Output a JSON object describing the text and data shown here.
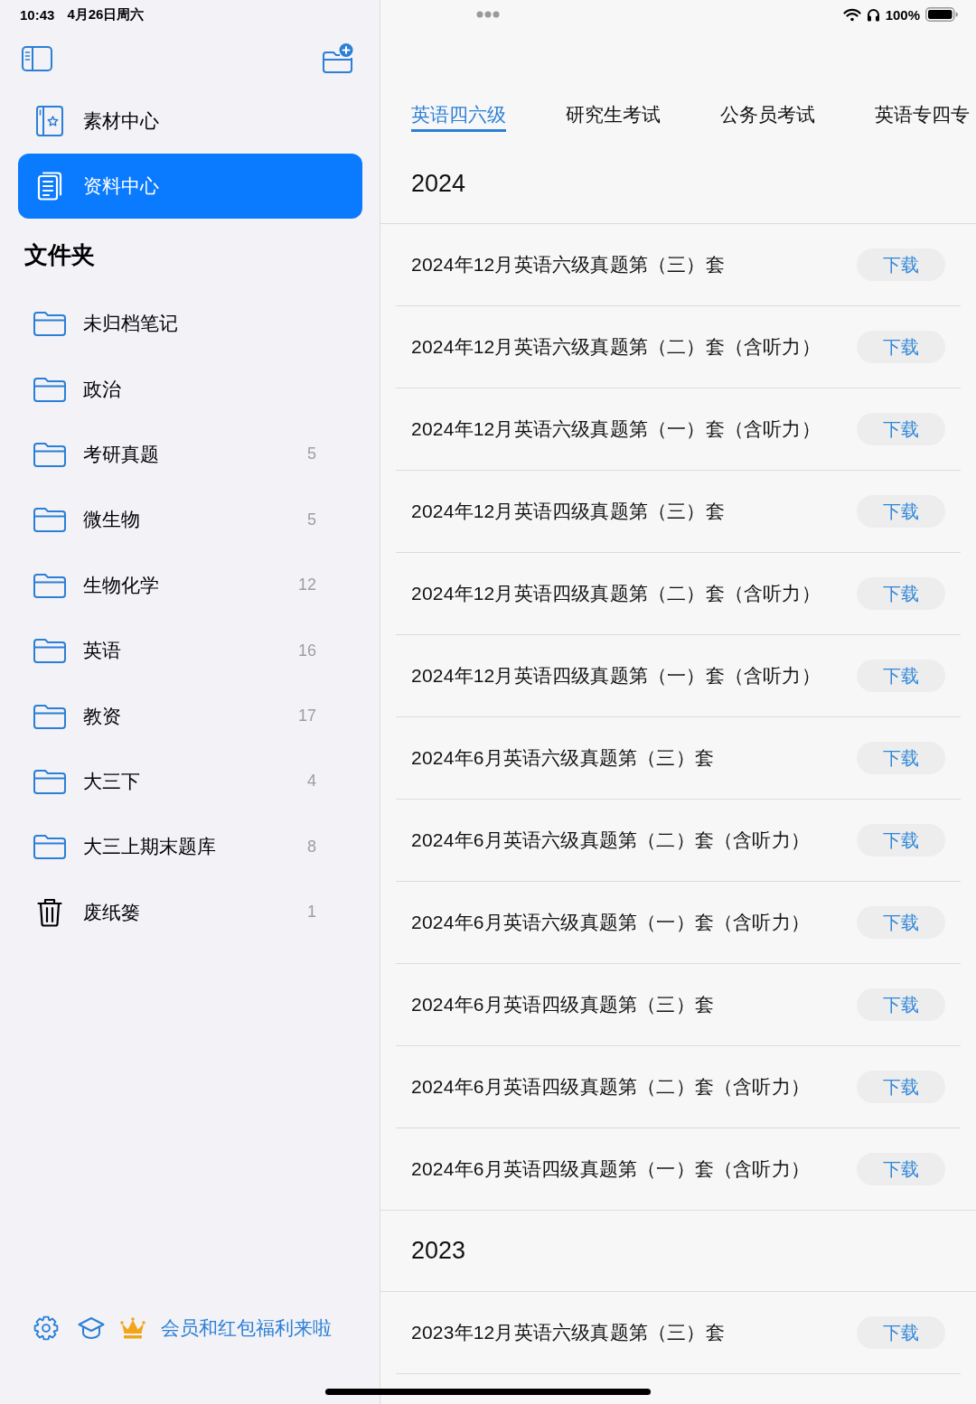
{
  "status_bar": {
    "time": "10:43",
    "date": "4月26日周六",
    "battery": "100%"
  },
  "sidebar": {
    "nav_items": [
      {
        "label": "素材中心",
        "kind": "book",
        "selected": false
      },
      {
        "label": "资料中心",
        "kind": "document",
        "selected": true
      }
    ],
    "folders_title": "文件夹",
    "folders": [
      {
        "name": "未归档笔记",
        "kind": "folder"
      },
      {
        "name": "政治",
        "kind": "folder"
      },
      {
        "name": "考研真题",
        "kind": "folder",
        "count": "5"
      },
      {
        "name": "微生物",
        "kind": "folder",
        "count": "5"
      },
      {
        "name": "生物化学",
        "kind": "folder",
        "count": "12"
      },
      {
        "name": "英语",
        "kind": "folder",
        "count": "16"
      },
      {
        "name": "教资",
        "kind": "folder",
        "count": "17"
      },
      {
        "name": "大三下",
        "kind": "folder",
        "count": "4"
      },
      {
        "name": "大三上期末题库",
        "kind": "folder",
        "count": "8"
      },
      {
        "name": "废纸篓",
        "kind": "trash",
        "count": "1"
      }
    ],
    "footer": {
      "promo": "会员和红包福利来啦"
    }
  },
  "tabs": [
    {
      "label": "英语四六级",
      "selected": true
    },
    {
      "label": "研究生考试",
      "selected": false
    },
    {
      "label": "公务员考试",
      "selected": false
    },
    {
      "label": "英语专四专",
      "selected": false
    }
  ],
  "sections": [
    {
      "year": "2024",
      "items": [
        {
          "title": "2024年12月英语六级真题第（三）套",
          "button": "下载"
        },
        {
          "title": "2024年12月英语六级真题第（二）套（含听力）",
          "button": "下载"
        },
        {
          "title": "2024年12月英语六级真题第（一）套（含听力）",
          "button": "下载"
        },
        {
          "title": "2024年12月英语四级真题第（三）套",
          "button": "下载"
        },
        {
          "title": "2024年12月英语四级真题第（二）套（含听力）",
          "button": "下载"
        },
        {
          "title": "2024年12月英语四级真题第（一）套（含听力）",
          "button": "下载"
        },
        {
          "title": "2024年6月英语六级真题第（三）套",
          "button": "下载"
        },
        {
          "title": "2024年6月英语六级真题第（二）套（含听力）",
          "button": "下载"
        },
        {
          "title": "2024年6月英语六级真题第（一）套（含听力）",
          "button": "下载"
        },
        {
          "title": "2024年6月英语四级真题第（三）套",
          "button": "下载"
        },
        {
          "title": "2024年6月英语四级真题第（二）套（含听力）",
          "button": "下载"
        },
        {
          "title": "2024年6月英语四级真题第（一）套（含听力）",
          "button": "下载"
        }
      ]
    },
    {
      "year": "2023",
      "items": [
        {
          "title": "2023年12月英语六级真题第（三）套",
          "button": "下载"
        }
      ]
    }
  ]
}
